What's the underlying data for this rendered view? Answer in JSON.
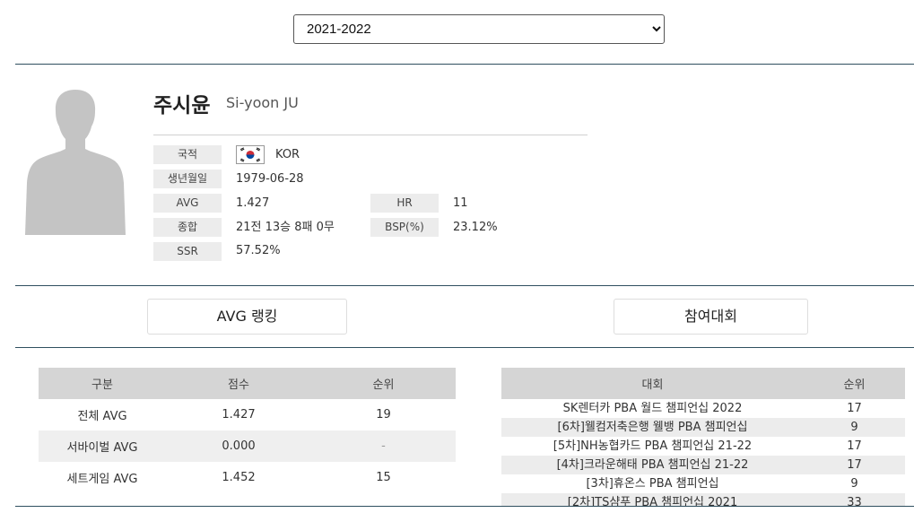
{
  "season": {
    "selected": "2021-2022",
    "options": [
      "2021-2022"
    ]
  },
  "player": {
    "name_ko": "주시윤",
    "name_en": "Si-yoon JU",
    "fields": {
      "nationality_label": "국적",
      "nationality_value": "KOR",
      "birth_label": "생년월일",
      "birth_value": "1979-06-28",
      "avg_label": "AVG",
      "avg_value": "1.427",
      "hr_label": "HR",
      "hr_value": "11",
      "record_label": "종합",
      "record_value": "21전 13승 8패 0무",
      "bsp_label": "BSP(%)",
      "bsp_value": "23.12%",
      "ssr_label": "SSR",
      "ssr_value": "57.52%"
    },
    "flag_icon": "korea-flag-icon",
    "avatar_icon": "person-silhouette-icon"
  },
  "tabs": {
    "avg_ranking": "AVG 랭킹",
    "competitions": "참여대회"
  },
  "avg_table": {
    "headers": [
      "구분",
      "점수",
      "순위"
    ],
    "rows": [
      {
        "category": "전체 AVG",
        "score": "1.427",
        "rank": "19"
      },
      {
        "category": "서바이벌 AVG",
        "score": "0.000",
        "rank": "-"
      },
      {
        "category": "세트게임 AVG",
        "score": "1.452",
        "rank": "15"
      }
    ]
  },
  "competition_table": {
    "headers": [
      "대회",
      "순위"
    ],
    "rows": [
      {
        "name": "SK렌터카 PBA 월드 챔피언십 2022",
        "rank": "17"
      },
      {
        "name": "[6차]웰컴저축은행 웰뱅 PBA 챔피언십",
        "rank": "9"
      },
      {
        "name": "[5차]NH농협카드 PBA 챔피언십 21-22",
        "rank": "17"
      },
      {
        "name": "[4차]크라운해태 PBA 챔피언십 21-22",
        "rank": "17"
      },
      {
        "name": "[3차]휴온스 PBA 챔피언십",
        "rank": "9"
      },
      {
        "name": "[2차]TS샴푸 PBA 챔피언십 2021",
        "rank": "33"
      }
    ]
  },
  "colors": {
    "divider": "#2f4f5f",
    "label_bg": "#ececec",
    "table_header_bg": "#d5d5d5",
    "flag_red": "#cd2e3a",
    "flag_blue": "#0047a0"
  }
}
